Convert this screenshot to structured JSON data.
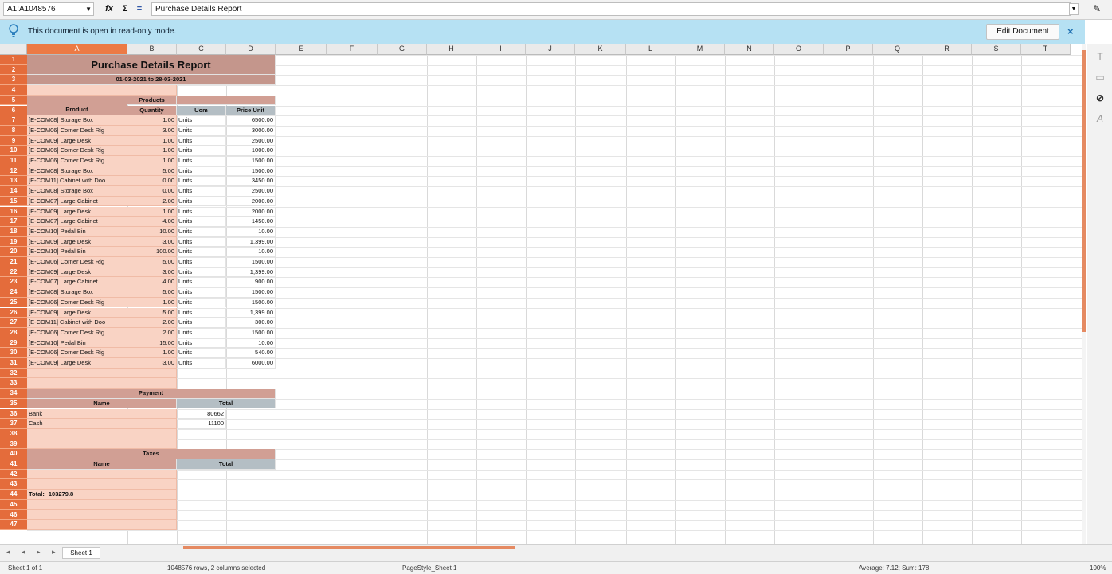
{
  "formula_bar": {
    "name_box": "A1:A1048576",
    "formula": "Purchase Details Report",
    "fx_label": "fx",
    "sum_label": "Σ",
    "equals_label": "="
  },
  "info_bar": {
    "message": "This document is open in read-only mode.",
    "edit_button": "Edit Document",
    "close": "×"
  },
  "columns": [
    "A",
    "B",
    "C",
    "D",
    "E",
    "F",
    "G",
    "H",
    "I",
    "J",
    "K",
    "L",
    "M",
    "N",
    "O",
    "P",
    "Q",
    "R",
    "S",
    "T"
  ],
  "rows": [
    "1",
    "2",
    "3",
    "4",
    "5",
    "6",
    "7",
    "8",
    "9",
    "10",
    "11",
    "12",
    "13",
    "14",
    "15",
    "16",
    "17",
    "18",
    "19",
    "20",
    "21",
    "22",
    "23",
    "24",
    "25",
    "26",
    "27",
    "28",
    "29",
    "30",
    "31",
    "32",
    "33",
    "34",
    "35",
    "36",
    "37",
    "38",
    "39",
    "40",
    "41",
    "42",
    "43",
    "44",
    "45",
    "46",
    "47"
  ],
  "report": {
    "title": "Purchase Details Report",
    "date_range": "01-03-2021 to 28-03-2021",
    "headers": {
      "product": "Product",
      "quantity_line1": "Products",
      "quantity_line2": "Quantity",
      "uom": "Uom",
      "price_unit": "Price Unit"
    },
    "lines": [
      {
        "product": "[E-COM08] Storage Box",
        "qty": "1.00",
        "uom": "Units",
        "price": "6500.00"
      },
      {
        "product": "[E-COM06] Corner Desk Rig",
        "qty": "3.00",
        "uom": "Units",
        "price": "3000.00"
      },
      {
        "product": "[E-COM09] Large Desk",
        "qty": "1.00",
        "uom": "Units",
        "price": "2500.00"
      },
      {
        "product": "[E-COM06] Corner Desk Rig",
        "qty": "1.00",
        "uom": "Units",
        "price": "1000.00"
      },
      {
        "product": "[E-COM06] Corner Desk Rig",
        "qty": "1.00",
        "uom": "Units",
        "price": "1500.00"
      },
      {
        "product": "[E-COM08] Storage Box",
        "qty": "5.00",
        "uom": "Units",
        "price": "1500.00"
      },
      {
        "product": "[E-COM11] Cabinet with Doo",
        "qty": "0.00",
        "uom": "Units",
        "price": "3450.00"
      },
      {
        "product": "[E-COM08] Storage Box",
        "qty": "0.00",
        "uom": "Units",
        "price": "2500.00"
      },
      {
        "product": "[E-COM07] Large Cabinet",
        "qty": "2.00",
        "uom": "Units",
        "price": "2000.00"
      },
      {
        "product": "[E-COM09] Large Desk",
        "qty": "1.00",
        "uom": "Units",
        "price": "2000.00"
      },
      {
        "product": "[E-COM07] Large Cabinet",
        "qty": "4.00",
        "uom": "Units",
        "price": "1450.00"
      },
      {
        "product": "[E-COM10] Pedal Bin",
        "qty": "10.00",
        "uom": "Units",
        "price": "10.00"
      },
      {
        "product": "[E-COM09] Large Desk",
        "qty": "3.00",
        "uom": "Units",
        "price": "1,399.00"
      },
      {
        "product": "[E-COM10] Pedal Bin",
        "qty": "100.00",
        "uom": "Units",
        "price": "10.00"
      },
      {
        "product": "[E-COM06] Corner Desk Rig",
        "qty": "5.00",
        "uom": "Units",
        "price": "1500.00"
      },
      {
        "product": "[E-COM09] Large Desk",
        "qty": "3.00",
        "uom": "Units",
        "price": "1,399.00"
      },
      {
        "product": "[E-COM07] Large Cabinet",
        "qty": "4.00",
        "uom": "Units",
        "price": "900.00"
      },
      {
        "product": "[E-COM08] Storage Box",
        "qty": "5.00",
        "uom": "Units",
        "price": "1500.00"
      },
      {
        "product": "[E-COM06] Corner Desk Rig",
        "qty": "1.00",
        "uom": "Units",
        "price": "1500.00"
      },
      {
        "product": "[E-COM09] Large Desk",
        "qty": "5.00",
        "uom": "Units",
        "price": "1,399.00"
      },
      {
        "product": "[E-COM11] Cabinet with Doo",
        "qty": "2.00",
        "uom": "Units",
        "price": "300.00"
      },
      {
        "product": "[E-COM06] Corner Desk Rig",
        "qty": "2.00",
        "uom": "Units",
        "price": "1500.00"
      },
      {
        "product": "[E-COM10] Pedal Bin",
        "qty": "15.00",
        "uom": "Units",
        "price": "10.00"
      },
      {
        "product": "[E-COM06] Corner Desk Rig",
        "qty": "1.00",
        "uom": "Units",
        "price": "540.00"
      },
      {
        "product": "[E-COM09] Large Desk",
        "qty": "3.00",
        "uom": "Units",
        "price": "6000.00"
      }
    ],
    "payment": {
      "section": "Payment",
      "name_header": "Name",
      "total_header": "Total",
      "rows": [
        {
          "name": "Bank",
          "total": "80662"
        },
        {
          "name": "Cash",
          "total": "11100"
        }
      ]
    },
    "taxes": {
      "section": "Taxes",
      "name_header": "Name",
      "total_header": "Total"
    },
    "total_label": "Total:",
    "total_value": "103279.8"
  },
  "tabs": {
    "sheet": "Sheet 1",
    "nav": "◂ ◂ ▸ ▸"
  },
  "status": {
    "sheet_pos": "Sheet 1 of 1",
    "selection": "1048576 rows, 2 columns selected",
    "page_style": "PageStyle_Sheet 1",
    "aggregate": "Average: 7.12; Sum: 178",
    "zoom": "100%"
  }
}
